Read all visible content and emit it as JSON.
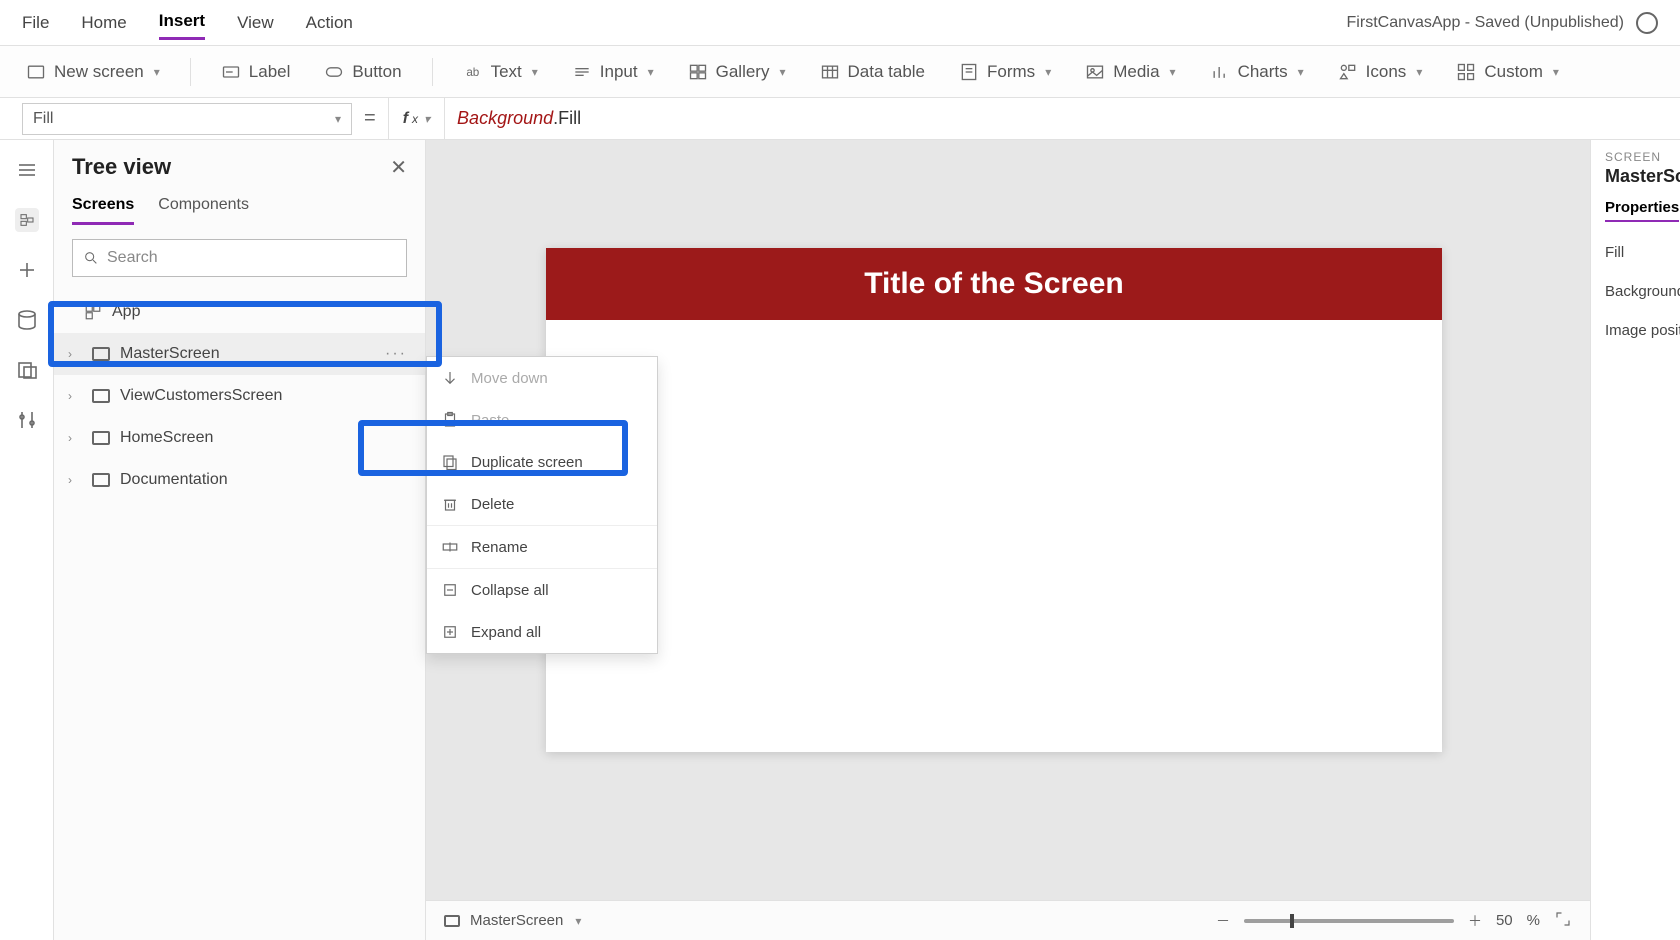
{
  "menu": {
    "tabs": [
      "File",
      "Home",
      "Insert",
      "View",
      "Action"
    ],
    "activeIndex": 2,
    "appTitle": "FirstCanvasApp - Saved (Unpublished)"
  },
  "ribbon": {
    "newScreen": "New screen",
    "label": "Label",
    "button": "Button",
    "text": "Text",
    "input": "Input",
    "gallery": "Gallery",
    "dataTable": "Data table",
    "forms": "Forms",
    "media": "Media",
    "charts": "Charts",
    "icons": "Icons",
    "custom": "Custom"
  },
  "formula": {
    "property": "Fill",
    "expressionObj": "Background",
    "expressionDot": ".",
    "expressionProp": "Fill"
  },
  "treeView": {
    "title": "Tree view",
    "tabs": {
      "screens": "Screens",
      "components": "Components"
    },
    "searchPlaceholder": "Search",
    "app": "App",
    "items": [
      {
        "label": "MasterScreen",
        "selected": true
      },
      {
        "label": "ViewCustomersScreen"
      },
      {
        "label": "HomeScreen"
      },
      {
        "label": "Documentation"
      }
    ]
  },
  "contextMenu": {
    "moveDown": "Move down",
    "paste": "Paste",
    "duplicate": "Duplicate screen",
    "delete": "Delete",
    "rename": "Rename",
    "collapseAll": "Collapse all",
    "expandAll": "Expand all"
  },
  "canvas": {
    "screenTitle": "Title of the Screen"
  },
  "statusBar": {
    "screenName": "MasterScreen",
    "zoomValue": "50",
    "zoomUnit": "%"
  },
  "properties": {
    "kindLabel": "SCREEN",
    "name": "MasterScreen",
    "tab": "Properties",
    "rows": [
      "Fill",
      "Background",
      "Image position"
    ]
  }
}
